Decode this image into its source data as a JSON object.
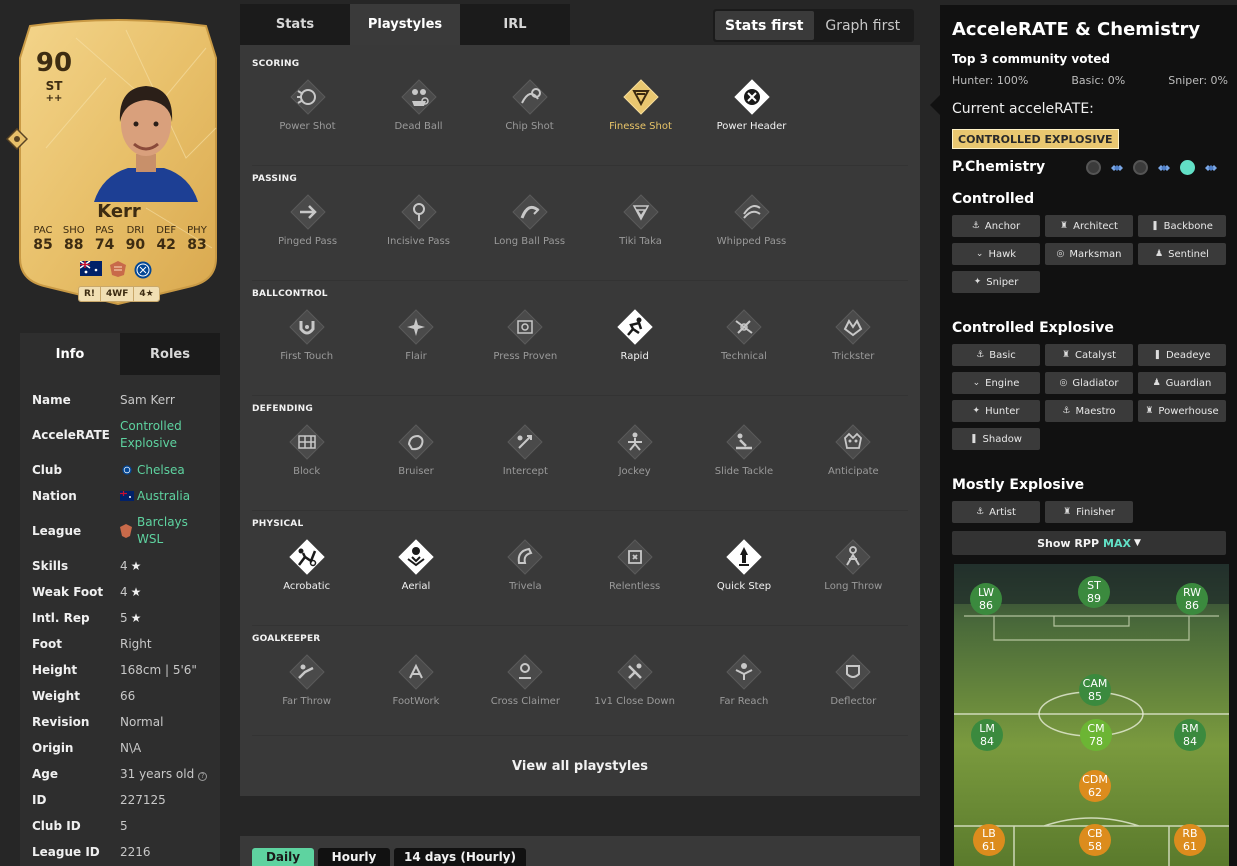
{
  "card": {
    "rating": "90",
    "position": "ST",
    "plus": "++",
    "name": "Kerr",
    "stats": [
      {
        "label": "PAC",
        "value": "85"
      },
      {
        "label": "SHO",
        "value": "88"
      },
      {
        "label": "PAS",
        "value": "74"
      },
      {
        "label": "DRI",
        "value": "90"
      },
      {
        "label": "DEF",
        "value": "42"
      },
      {
        "label": "PHY",
        "value": "83"
      }
    ],
    "ribbon": [
      "R!",
      "4WF",
      "4★"
    ]
  },
  "info": {
    "tabs": [
      "Info",
      "Roles"
    ],
    "rows": [
      {
        "key": "Name",
        "value": "Sam Kerr"
      },
      {
        "key": "AcceleRATE",
        "value": "Controlled Explosive"
      },
      {
        "key": "Club",
        "value": "Chelsea"
      },
      {
        "key": "Nation",
        "value": "Australia"
      },
      {
        "key": "League",
        "value": "Barclays WSL"
      },
      {
        "key": "Skills",
        "value": "4"
      },
      {
        "key": "Weak Foot",
        "value": "4"
      },
      {
        "key": "Intl. Rep",
        "value": "5"
      },
      {
        "key": "Foot",
        "value": "Right"
      },
      {
        "key": "Height",
        "value": "168cm | 5'6\""
      },
      {
        "key": "Weight",
        "value": "66"
      },
      {
        "key": "Revision",
        "value": "Normal"
      },
      {
        "key": "Origin",
        "value": "N\\A"
      },
      {
        "key": "Age",
        "value": "31 years old"
      },
      {
        "key": "ID",
        "value": "227125"
      },
      {
        "key": "Club ID",
        "value": "5"
      },
      {
        "key": "League ID",
        "value": "2216"
      }
    ]
  },
  "tabs": [
    "Stats",
    "Playstyles",
    "IRL"
  ],
  "toggle": [
    "Stats first",
    "Graph first"
  ],
  "playstyles": {
    "sections": [
      {
        "title": "SCORING",
        "items": [
          {
            "label": "Power Shot",
            "state": "off",
            "icon": "power-shot"
          },
          {
            "label": "Dead Ball",
            "state": "off",
            "icon": "dead-ball"
          },
          {
            "label": "Chip Shot",
            "state": "off",
            "icon": "chip-shot"
          },
          {
            "label": "Finesse Shot",
            "state": "plus",
            "icon": "finesse-shot"
          },
          {
            "label": "Power Header",
            "state": "on",
            "icon": "power-header"
          }
        ]
      },
      {
        "title": "PASSING",
        "items": [
          {
            "label": "Pinged Pass",
            "state": "off",
            "icon": "pinged-pass"
          },
          {
            "label": "Incisive Pass",
            "state": "off",
            "icon": "incisive-pass"
          },
          {
            "label": "Long Ball Pass",
            "state": "off",
            "icon": "long-ball-pass"
          },
          {
            "label": "Tiki Taka",
            "state": "off",
            "icon": "tiki-taka"
          },
          {
            "label": "Whipped Pass",
            "state": "off",
            "icon": "whipped-pass"
          }
        ]
      },
      {
        "title": "BALLCONTROL",
        "items": [
          {
            "label": "First Touch",
            "state": "off",
            "icon": "first-touch"
          },
          {
            "label": "Flair",
            "state": "off",
            "icon": "flair"
          },
          {
            "label": "Press Proven",
            "state": "off",
            "icon": "press-proven"
          },
          {
            "label": "Rapid",
            "state": "on",
            "icon": "rapid"
          },
          {
            "label": "Technical",
            "state": "off",
            "icon": "technical"
          },
          {
            "label": "Trickster",
            "state": "off",
            "icon": "trickster"
          }
        ]
      },
      {
        "title": "DEFENDING",
        "items": [
          {
            "label": "Block",
            "state": "off",
            "icon": "block"
          },
          {
            "label": "Bruiser",
            "state": "off",
            "icon": "bruiser"
          },
          {
            "label": "Intercept",
            "state": "off",
            "icon": "intercept"
          },
          {
            "label": "Jockey",
            "state": "off",
            "icon": "jockey"
          },
          {
            "label": "Slide Tackle",
            "state": "off",
            "icon": "slide-tackle"
          },
          {
            "label": "Anticipate",
            "state": "off",
            "icon": "anticipate"
          }
        ]
      },
      {
        "title": "PHYSICAL",
        "items": [
          {
            "label": "Acrobatic",
            "state": "on",
            "icon": "acrobatic"
          },
          {
            "label": "Aerial",
            "state": "on",
            "icon": "aerial"
          },
          {
            "label": "Trivela",
            "state": "off",
            "icon": "trivela"
          },
          {
            "label": "Relentless",
            "state": "off",
            "icon": "relentless"
          },
          {
            "label": "Quick Step",
            "state": "on",
            "icon": "quick-step"
          },
          {
            "label": "Long Throw",
            "state": "off",
            "icon": "long-throw"
          }
        ]
      },
      {
        "title": "GOALKEEPER",
        "items": [
          {
            "label": "Far Throw",
            "state": "off",
            "icon": "far-throw"
          },
          {
            "label": "FootWork",
            "state": "off",
            "icon": "footwork"
          },
          {
            "label": "Cross Claimer",
            "state": "off",
            "icon": "cross-claimer"
          },
          {
            "label": "1v1 Close Down",
            "state": "off",
            "icon": "close-down"
          },
          {
            "label": "Far Reach",
            "state": "off",
            "icon": "far-reach"
          },
          {
            "label": "Deflector",
            "state": "off",
            "icon": "deflector"
          }
        ]
      }
    ],
    "view_all": "View all playstyles"
  },
  "bottom_tabs": [
    "Daily",
    "Hourly",
    "14 days (Hourly)"
  ],
  "right": {
    "title": "AcceleRATE & Chemistry",
    "subtitle": "Top 3 community voted",
    "votes": [
      "Hunter: 100%",
      "Basic: 0%",
      "Sniper: 0%"
    ],
    "current_label": "Current acceleRATE:",
    "current_value": "CONTROLLED EXPLOSIVE",
    "pchem": "P.Chemistry",
    "groups": [
      {
        "title": "Controlled",
        "chips": [
          "Anchor",
          "Architect",
          "Backbone",
          "Hawk",
          "Marksman",
          "Sentinel",
          "Sniper"
        ]
      },
      {
        "title": "Controlled Explosive",
        "chips": [
          "Basic",
          "Catalyst",
          "Deadeye",
          "Engine",
          "Gladiator",
          "Guardian",
          "Hunter",
          "Maestro",
          "Powerhouse",
          "Shadow"
        ]
      },
      {
        "title": "Mostly Explosive",
        "chips": [
          "Artist",
          "Finisher"
        ]
      }
    ],
    "rpp_label": "Show RPP",
    "rpp_value": "MAX"
  },
  "positions": [
    {
      "pos": "LW",
      "rating": "86"
    },
    {
      "pos": "ST",
      "rating": "89"
    },
    {
      "pos": "RW",
      "rating": "86"
    },
    {
      "pos": "CAM",
      "rating": "85"
    },
    {
      "pos": "LM",
      "rating": "84"
    },
    {
      "pos": "CM",
      "rating": "78"
    },
    {
      "pos": "RM",
      "rating": "84"
    },
    {
      "pos": "CDM",
      "rating": "62"
    },
    {
      "pos": "LB",
      "rating": "61"
    },
    {
      "pos": "CB",
      "rating": "58"
    },
    {
      "pos": "RB",
      "rating": "61"
    }
  ],
  "colors": {
    "accent": "#5ed3a0",
    "gold": "#e9c770",
    "panel": "#393939"
  }
}
